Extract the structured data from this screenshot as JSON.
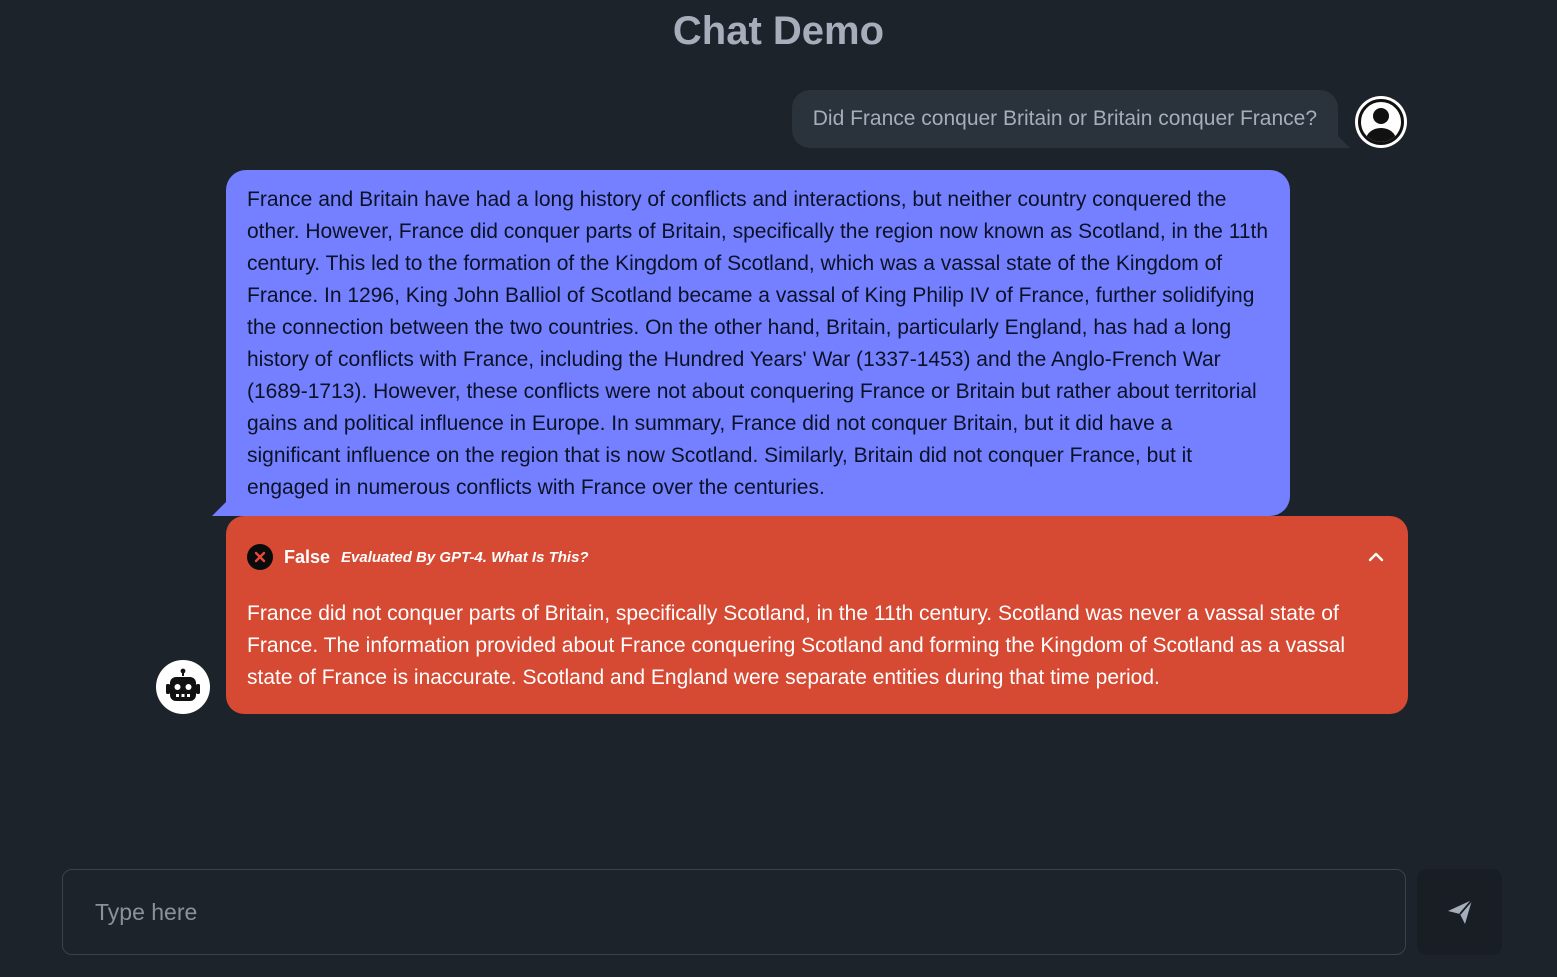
{
  "header": {
    "title": "Chat Demo"
  },
  "messages": {
    "user": {
      "text": "Did France conquer Britain or Britain conquer France?",
      "avatar_icon": "user-icon"
    },
    "assistant": {
      "text": "France and Britain have had a long history of conflicts and interactions, but neither country conquered the other. However, France did conquer parts of Britain, specifically the region now known as Scotland, in the 11th century. This led to the formation of the Kingdom of Scotland, which was a vassal state of the Kingdom of France. In 1296, King John Balliol of Scotland became a vassal of King Philip IV of France, further solidifying the connection between the two countries. On the other hand, Britain, particularly England, has had a long history of conflicts with France, including the Hundred Years' War (1337-1453) and the Anglo-French War (1689-1713). However, these conflicts were not about conquering France or Britain but rather about territorial gains and political influence in Europe. In summary, France did not conquer Britain, but it did have a significant influence on the region that is now Scotland. Similarly, Britain did not conquer France, but it engaged in numerous conflicts with France over the centuries.",
      "avatar_icon": "robot-icon"
    }
  },
  "evaluation": {
    "verdict": "False",
    "evaluated_by": "Evaluated By GPT-4. What Is This?",
    "explanation": "France did not conquer parts of Britain, specifically Scotland, in the 11th century. Scotland was never a vassal state of France. The information provided about France conquering Scotland and forming the Kingdom of Scotland as a vassal state of France is inaccurate. Scotland and England were separate entities during that time period.",
    "status_icon": "x-circle-icon",
    "toggle_icon": "chevron-up-icon"
  },
  "composer": {
    "placeholder": "Type here",
    "value": "",
    "send_icon": "send-icon"
  },
  "colors": {
    "background": "#1d232a",
    "user_bubble": "#2a323c",
    "assistant_bubble": "#7480ff",
    "evaluation_false": "#d64933"
  }
}
